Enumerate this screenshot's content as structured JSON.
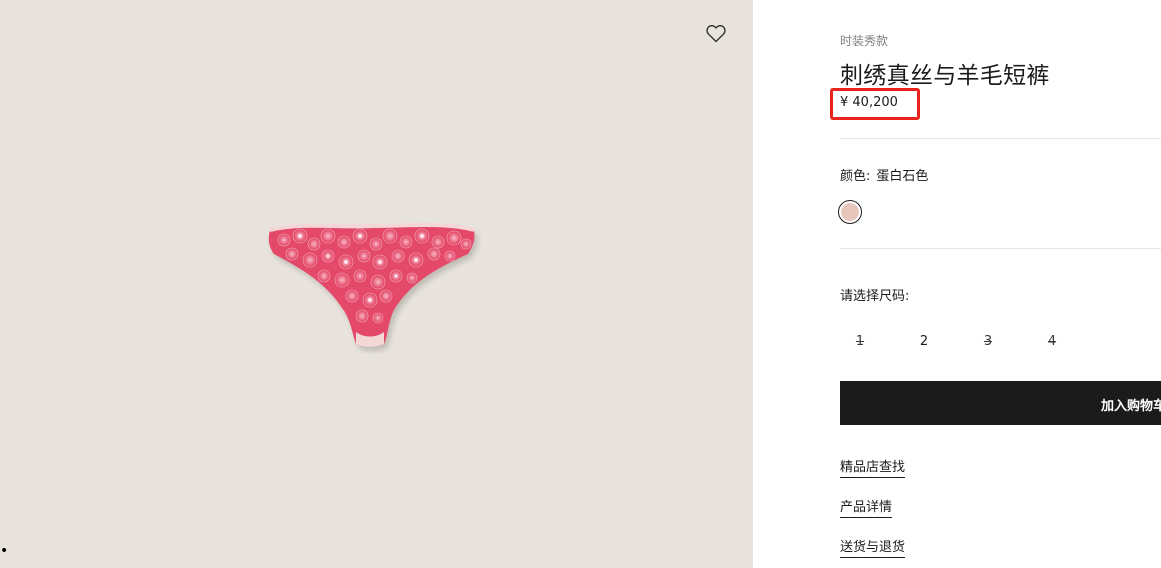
{
  "product": {
    "category": "时装秀款",
    "title": "刺绣真丝与羊毛短裤",
    "price": "¥ 40,200",
    "color_label": "颜色:",
    "color_value": "蛋白石色",
    "swatch_color": "#e7c6bb",
    "size_label": "请选择尺码:",
    "sizes": [
      {
        "label": "1",
        "available": false
      },
      {
        "label": "2",
        "available": true
      },
      {
        "label": "3",
        "available": false
      },
      {
        "label": "4",
        "available": false
      }
    ],
    "add_to_cart_label": "加入购物车"
  },
  "links": {
    "store_finder": "精品店查找",
    "product_details": "产品详情",
    "shipping_returns": "送货与退货"
  },
  "colors": {
    "image_background": "#e8e3dc",
    "price_highlight": "#e8231c",
    "button_background": "#1b1b1b"
  },
  "icons": {
    "wishlist": "heart-outline-icon"
  }
}
